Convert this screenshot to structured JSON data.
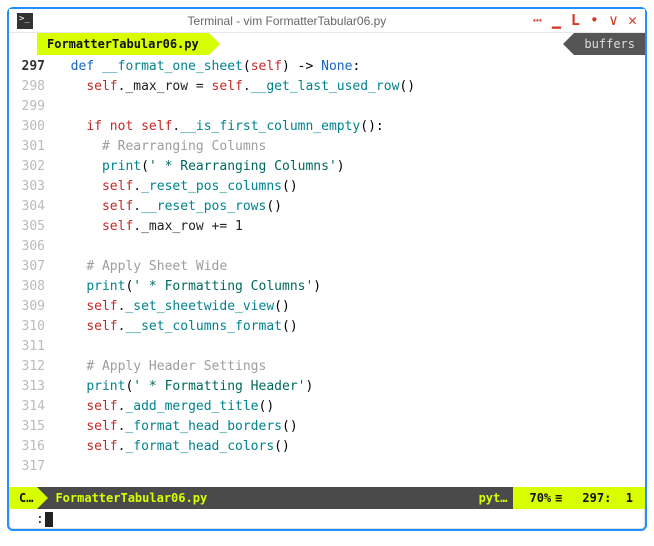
{
  "window": {
    "title": "Terminal - vim FormatterTabular06.py"
  },
  "tabs": {
    "active": "FormatterTabular06.py",
    "buffers_label": "buffers"
  },
  "code": {
    "lines": [
      {
        "n": 297,
        "current": true,
        "segs": [
          [
            "  ",
            ""
          ],
          [
            "def",
            "kw-def"
          ],
          [
            " ",
            ""
          ],
          [
            "__format_one_sheet",
            "fn-name"
          ],
          [
            "(",
            ""
          ],
          [
            "self",
            "kw-self"
          ],
          [
            ") -> ",
            ""
          ],
          [
            "None",
            "kw-none"
          ],
          [
            ":",
            ""
          ]
        ]
      },
      {
        "n": 298,
        "current": false,
        "segs": [
          [
            "    ",
            ""
          ],
          [
            "self",
            "kw-self"
          ],
          [
            "._max_row = ",
            "plain"
          ],
          [
            "self",
            "kw-self"
          ],
          [
            ".",
            "plain"
          ],
          [
            "__get_last_used_row",
            "fn-call"
          ],
          [
            "()",
            ""
          ]
        ]
      },
      {
        "n": 299,
        "current": false,
        "segs": [
          [
            "",
            ""
          ]
        ]
      },
      {
        "n": 300,
        "current": false,
        "segs": [
          [
            "    ",
            ""
          ],
          [
            "if not",
            "kw-if"
          ],
          [
            " ",
            ""
          ],
          [
            "self",
            "kw-self"
          ],
          [
            ".",
            "plain"
          ],
          [
            "__is_first_column_empty",
            "fn-call"
          ],
          [
            "():",
            ""
          ]
        ]
      },
      {
        "n": 301,
        "current": false,
        "segs": [
          [
            "      ",
            ""
          ],
          [
            "# Rearranging Columns",
            "comment"
          ]
        ]
      },
      {
        "n": 302,
        "current": false,
        "segs": [
          [
            "      ",
            ""
          ],
          [
            "print",
            "fn-call"
          ],
          [
            "(",
            ""
          ],
          [
            "' * Rearranging Columns'",
            "string"
          ],
          [
            ")",
            ""
          ]
        ]
      },
      {
        "n": 303,
        "current": false,
        "segs": [
          [
            "      ",
            ""
          ],
          [
            "self",
            "kw-self"
          ],
          [
            ".",
            "plain"
          ],
          [
            "_reset_pos_columns",
            "fn-call"
          ],
          [
            "()",
            ""
          ]
        ]
      },
      {
        "n": 304,
        "current": false,
        "segs": [
          [
            "      ",
            ""
          ],
          [
            "self",
            "kw-self"
          ],
          [
            ".",
            "plain"
          ],
          [
            "__reset_pos_rows",
            "fn-call"
          ],
          [
            "()",
            ""
          ]
        ]
      },
      {
        "n": 305,
        "current": false,
        "segs": [
          [
            "      ",
            ""
          ],
          [
            "self",
            "kw-self"
          ],
          [
            "._max_row += ",
            "plain"
          ],
          [
            "1",
            "plain"
          ]
        ]
      },
      {
        "n": 306,
        "current": false,
        "segs": [
          [
            "",
            ""
          ]
        ]
      },
      {
        "n": 307,
        "current": false,
        "segs": [
          [
            "    ",
            ""
          ],
          [
            "# Apply Sheet Wide",
            "comment"
          ]
        ]
      },
      {
        "n": 308,
        "current": false,
        "segs": [
          [
            "    ",
            ""
          ],
          [
            "print",
            "fn-call"
          ],
          [
            "(",
            ""
          ],
          [
            "' * Formatting Columns'",
            "string"
          ],
          [
            ")",
            ""
          ]
        ]
      },
      {
        "n": 309,
        "current": false,
        "segs": [
          [
            "    ",
            ""
          ],
          [
            "self",
            "kw-self"
          ],
          [
            ".",
            "plain"
          ],
          [
            "_set_sheetwide_view",
            "fn-call"
          ],
          [
            "()",
            ""
          ]
        ]
      },
      {
        "n": 310,
        "current": false,
        "segs": [
          [
            "    ",
            ""
          ],
          [
            "self",
            "kw-self"
          ],
          [
            ".",
            "plain"
          ],
          [
            "__set_columns_format",
            "fn-call"
          ],
          [
            "()",
            ""
          ]
        ]
      },
      {
        "n": 311,
        "current": false,
        "segs": [
          [
            "",
            ""
          ]
        ]
      },
      {
        "n": 312,
        "current": false,
        "segs": [
          [
            "    ",
            ""
          ],
          [
            "# Apply Header Settings",
            "comment"
          ]
        ]
      },
      {
        "n": 313,
        "current": false,
        "segs": [
          [
            "    ",
            ""
          ],
          [
            "print",
            "fn-call"
          ],
          [
            "(",
            ""
          ],
          [
            "' * Formatting Header'",
            "string"
          ],
          [
            ")",
            ""
          ]
        ]
      },
      {
        "n": 314,
        "current": false,
        "segs": [
          [
            "    ",
            ""
          ],
          [
            "self",
            "kw-self"
          ],
          [
            ".",
            "plain"
          ],
          [
            "_add_merged_title",
            "fn-call"
          ],
          [
            "()",
            ""
          ]
        ]
      },
      {
        "n": 315,
        "current": false,
        "segs": [
          [
            "    ",
            ""
          ],
          [
            "self",
            "kw-self"
          ],
          [
            ".",
            "plain"
          ],
          [
            "_format_head_borders",
            "fn-call"
          ],
          [
            "()",
            ""
          ]
        ]
      },
      {
        "n": 316,
        "current": false,
        "segs": [
          [
            "    ",
            ""
          ],
          [
            "self",
            "kw-self"
          ],
          [
            ".",
            "plain"
          ],
          [
            "_format_head_colors",
            "fn-call"
          ],
          [
            "()",
            ""
          ]
        ]
      },
      {
        "n": 317,
        "current": false,
        "segs": [
          [
            "",
            ""
          ]
        ]
      }
    ]
  },
  "status": {
    "mode": "C…",
    "file": "FormatterTabular06.py",
    "filetype": "pyt…",
    "percent": "70%",
    "icon": "≡",
    "line": "297",
    "col": "1"
  },
  "cmdline": {
    "prefix": ":"
  }
}
